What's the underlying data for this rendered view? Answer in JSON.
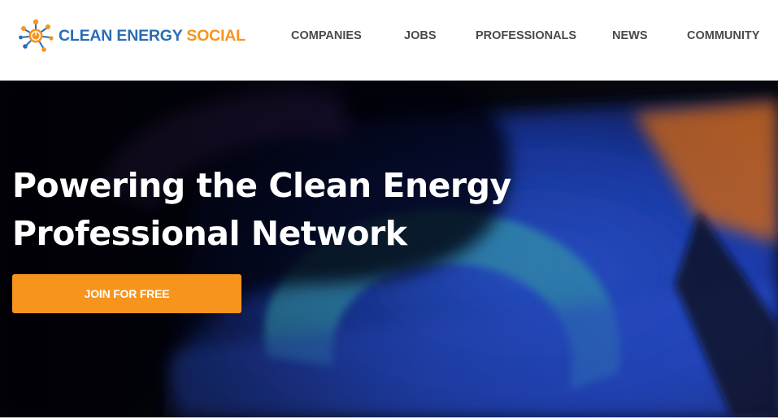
{
  "brand": {
    "name_part1": "CLEAN ENERGY",
    "name_part2": "SOCIAL",
    "logo_icon": "network-sun-icon",
    "colors": {
      "blue": "#2a6db5",
      "orange": "#f7941d"
    }
  },
  "nav": {
    "items": [
      {
        "label": "COMPANIES"
      },
      {
        "label": "JOBS"
      },
      {
        "label": "PROFESSIONALS"
      },
      {
        "label": "NEWS"
      },
      {
        "label": "COMMUNITY"
      }
    ],
    "text_color": "#4a4a4a"
  },
  "hero": {
    "title_line1": "Powering the Clean Energy",
    "title_line2": "Professional Network",
    "cta_label": "JOIN FOR FREE",
    "cta_color": "#f7941d",
    "background": "hand-on-smart-thermostat-photo"
  }
}
